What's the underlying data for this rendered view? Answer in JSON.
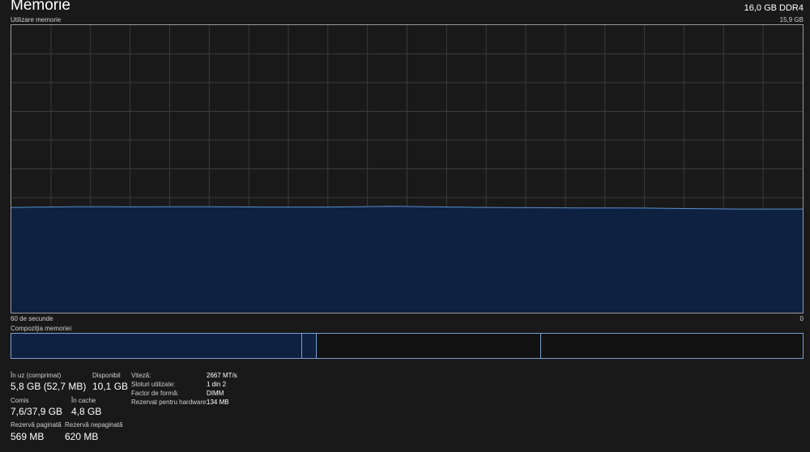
{
  "header": {
    "title": "Memorie",
    "ram_spec": "16,0 GB DDR4"
  },
  "graph": {
    "label": "Utilizare memorie",
    "max_label": "15,9 GB",
    "time_left": "60 de secunde",
    "time_right": "0",
    "max_gb": 15.9,
    "usage_gb": [
      5.82,
      5.84,
      5.86,
      5.86,
      5.85,
      5.86,
      5.86,
      5.85,
      5.84,
      5.83,
      5.84,
      5.86,
      5.88,
      5.86,
      5.84,
      5.82,
      5.81,
      5.8,
      5.79,
      5.79,
      5.78,
      5.76,
      5.74,
      5.73,
      5.73,
      5.73
    ]
  },
  "composition": {
    "label": "Compoziţia memoriei",
    "segments": [
      {
        "name": "in-use",
        "fraction": 0.366,
        "color": "#0e2140"
      },
      {
        "name": "modified",
        "fraction": 0.019,
        "color": "#0e2140"
      },
      {
        "name": "standby",
        "fraction": 0.283,
        "color": "#121212"
      },
      {
        "name": "free",
        "fraction": 0.332,
        "color": "#121212"
      }
    ]
  },
  "stats": {
    "in_use_label": "În uz (comprimat)",
    "in_use_value": "5,8 GB (52,7 MB)",
    "available_label": "Disponibil",
    "available_value": "10,1 GB",
    "committed_label": "Comis",
    "committed_value": "7,6/37,9 GB",
    "cached_label": "În cache",
    "cached_value": "4,8 GB",
    "paged_label": "Rezervă paginată",
    "paged_value": "569 MB",
    "nonpaged_label": "Rezervă nepaginată",
    "nonpaged_value": "620 MB"
  },
  "specs": {
    "speed_label": "Viteză:",
    "speed_value": "2667 MT/s",
    "slots_label": "Sloturi utilizate:",
    "slots_value": "1 din 2",
    "form_label": "Factor de formă:",
    "form_value": "DIMM",
    "reserved_label": "Rezervat pentru hardware:",
    "reserved_value": "134 MB"
  },
  "colors": {
    "background": "#191919",
    "grid": "#3a3a3a",
    "fill": "#0e2140",
    "line": "#5a8fd0"
  }
}
